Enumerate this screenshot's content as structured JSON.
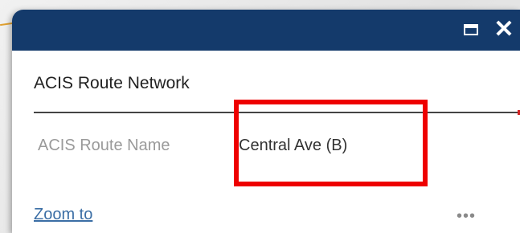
{
  "popup": {
    "title": "ACIS Route Network",
    "field": {
      "label": "ACIS Route Name",
      "value": "Central Ave (B)"
    },
    "actions": {
      "zoom_label": "Zoom to",
      "more_label": "•••"
    },
    "header_buttons": {
      "maximize_icon": "maximize-icon",
      "close_symbol": "✕"
    }
  },
  "colors": {
    "header": "#143a6b",
    "highlight": "#ee0000",
    "link": "#3b6ea5"
  }
}
